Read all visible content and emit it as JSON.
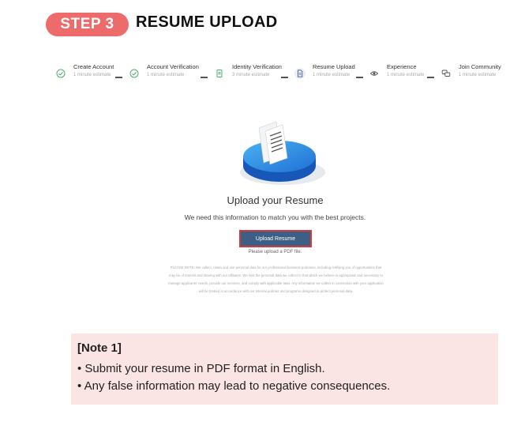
{
  "header": {
    "step_badge": "STEP 3",
    "title": "RESUME UPLOAD"
  },
  "stepper": [
    {
      "label": "Create Account",
      "estimate": "1 minute estimate",
      "icon": "check-circle-icon",
      "status": "done"
    },
    {
      "label": "Account Verification",
      "estimate": "1 minute estimate",
      "icon": "check-circle-icon",
      "status": "done"
    },
    {
      "label": "Identity Verification",
      "estimate": "3 minute estimate",
      "icon": "id-card-icon",
      "status": "done"
    },
    {
      "label": "Resume Upload",
      "estimate": "1 minute estimate",
      "icon": "document-icon",
      "status": "active"
    },
    {
      "label": "Experience",
      "estimate": "1 minute estimate",
      "icon": "eye-icon",
      "status": "pending"
    },
    {
      "label": "Join Community",
      "estimate": "1 minute estimate",
      "icon": "chat-bubbles-icon",
      "status": "pending"
    }
  ],
  "upload": {
    "heading": "Upload your Resume",
    "subtext": "We need this information to match you with the best projects.",
    "button_label": "Upload Resume",
    "hint": "Please upload a PDF file.",
    "notice": "PLEASE NOTE: We collect, retain and use personal data for our professional business purposes, including notifying you of opportunities that may be of interest and sharing with our affiliates. We limit the personal data we collect to that which we believe is appropriate and necessary to manage applicants' needs, provide our services, and comply with applicable laws. Any information we collect in connection with your application will be treated in accordance with our internal policies and programs designed to protect personal data."
  },
  "note": {
    "title": "[Note 1]",
    "items": [
      "• Submit your resume in PDF format in English.",
      "• Any false information may lead to negative consequences."
    ]
  },
  "colors": {
    "badge": "#ee6b6b",
    "button": "#3d5f86",
    "button_border": "#d23b3b",
    "note_bg": "#fbe4e4",
    "check": "#4caf6d"
  }
}
